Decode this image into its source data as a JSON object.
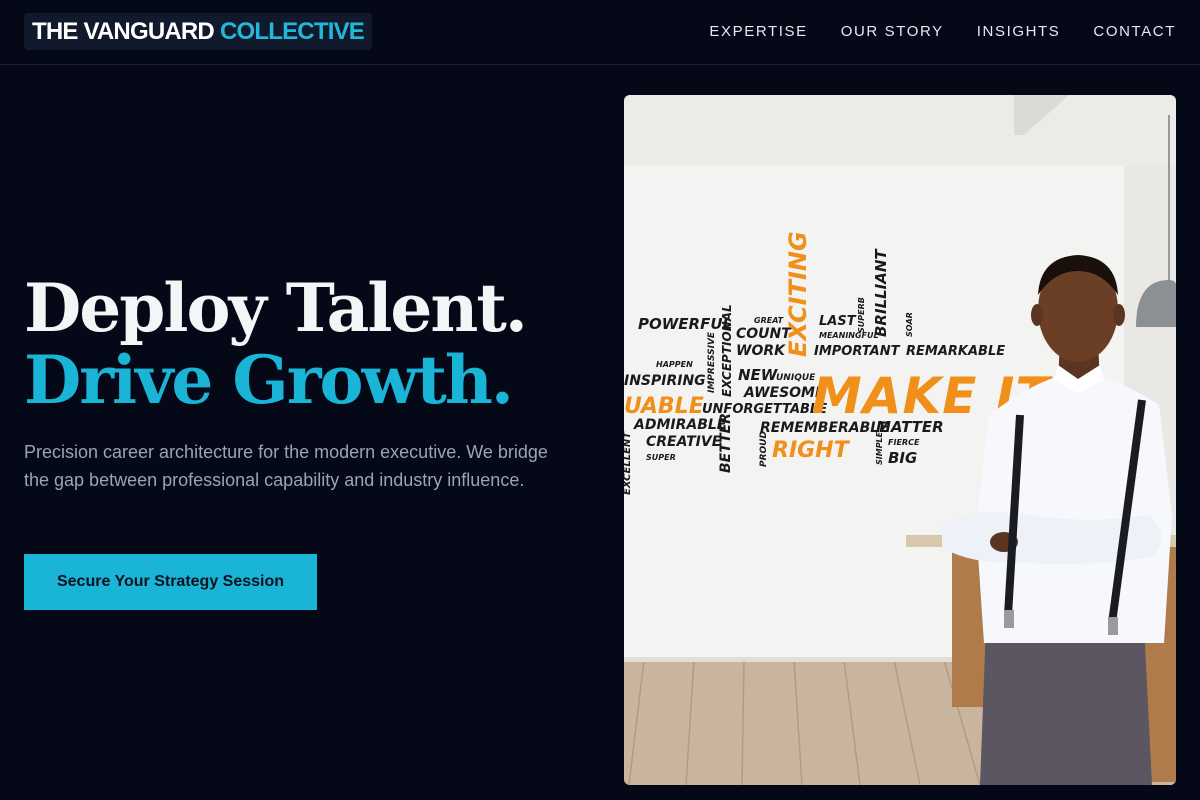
{
  "brand": {
    "name_part1": "THE VANGUARD",
    "name_part2": "COLLECTIVE",
    "accent_color": "#19b4d6"
  },
  "nav": {
    "items": [
      {
        "label": "EXPERTISE"
      },
      {
        "label": "OUR STORY"
      },
      {
        "label": "INSIGHTS"
      },
      {
        "label": "CONTACT"
      }
    ]
  },
  "hero": {
    "title_line1": "Deploy Talent.",
    "title_line2": "Drive Growth.",
    "subtitle": "Precision career architecture for the modern executive. We bridge the gap between professional capability and industry influence.",
    "cta_label": "Secure Your Strategy Session"
  },
  "image": {
    "wall_words": {
      "powerful": "POWERFUL",
      "great": "GREAT",
      "count": "COUNT",
      "work": "WORK",
      "exciting": "EXCITING",
      "last": "LAST",
      "meaningful": "MEANINGFUL",
      "important": "IMPORTANT",
      "superb": "SUPERB",
      "brilliant": "BRILLIANT",
      "soar": "SOAR",
      "remarkable": "REMARKABLE",
      "happen": "HAPPEN",
      "inspiring": "INSPIRING",
      "impressive": "IMPRESSIVE",
      "exceptional": "EXCEPTIONAL",
      "new": "NEW",
      "unique": "UNIQUE",
      "awesome": "AWESOME",
      "make_it": "MAKE IT",
      "uable": "UABLE",
      "unforgettable": "UNFORGETTABLE",
      "admirable": "ADMIRABLE",
      "creative": "CREATIVE",
      "super": "SUPER",
      "better": "BETTER",
      "rememberable": "REMEMBERABLE",
      "matter": "MATTER",
      "proud": "PROUD",
      "right": "RIGHT",
      "simple": "SIMPLE",
      "fierce": "FIERCE",
      "big": "BIG",
      "excellent": "EXCELLENT"
    }
  }
}
